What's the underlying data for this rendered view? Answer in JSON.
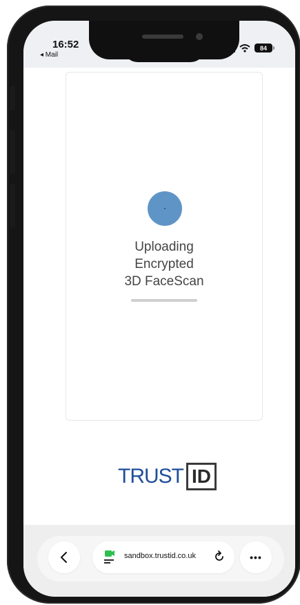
{
  "status_bar": {
    "time": "16:52",
    "back_app": "◂ Mail",
    "battery": "84"
  },
  "upload": {
    "line1": "Uploading",
    "line2": "Encrypted",
    "line3": "3D FaceScan",
    "progress": 0
  },
  "logo": {
    "trust": "TRUST",
    "id": "ID"
  },
  "browser": {
    "url": "sandbox.trustid.co.uk",
    "back_icon": "chevron-left",
    "reload_icon": "reload",
    "more_icon": "ellipsis",
    "more_label": "•••",
    "back_label": "‹",
    "reload_label": "↻"
  },
  "colors": {
    "spinner": "#5f95c6",
    "trust_blue": "#1f4e9a",
    "site_icon_green": "#2fbf4f"
  }
}
